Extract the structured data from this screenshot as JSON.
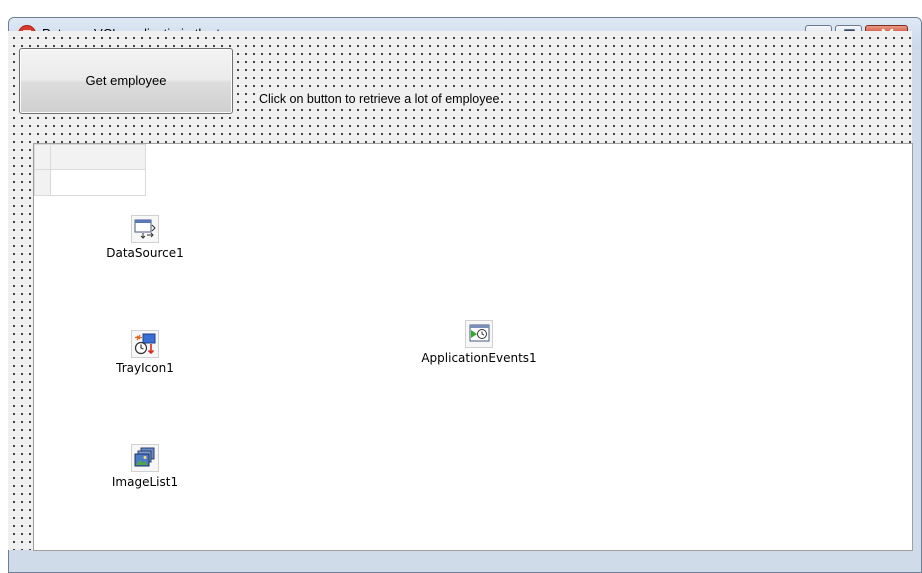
{
  "window": {
    "title": "Put your VCL applicatin in the tray",
    "app_icon": "app-logo-icon",
    "controls": [
      "minimize-icon",
      "maximize-icon",
      "close-icon"
    ]
  },
  "form": {
    "button_label": "Get employee",
    "hint_label": "Click on button to retrieve a lot of employee"
  },
  "components": [
    {
      "label": "DataSource1",
      "icon": "datasource-icon"
    },
    {
      "label": "TrayIcon1",
      "icon": "trayicon-icon"
    },
    {
      "label": "ImageList1",
      "icon": "imagelist-icon"
    },
    {
      "label": "ApplicationEvents1",
      "icon": "applicationevents-icon"
    }
  ],
  "colors": {
    "titlebar": "#cfdbe9",
    "close_button": "#c7412b",
    "app_icon": "#d93a2b"
  }
}
